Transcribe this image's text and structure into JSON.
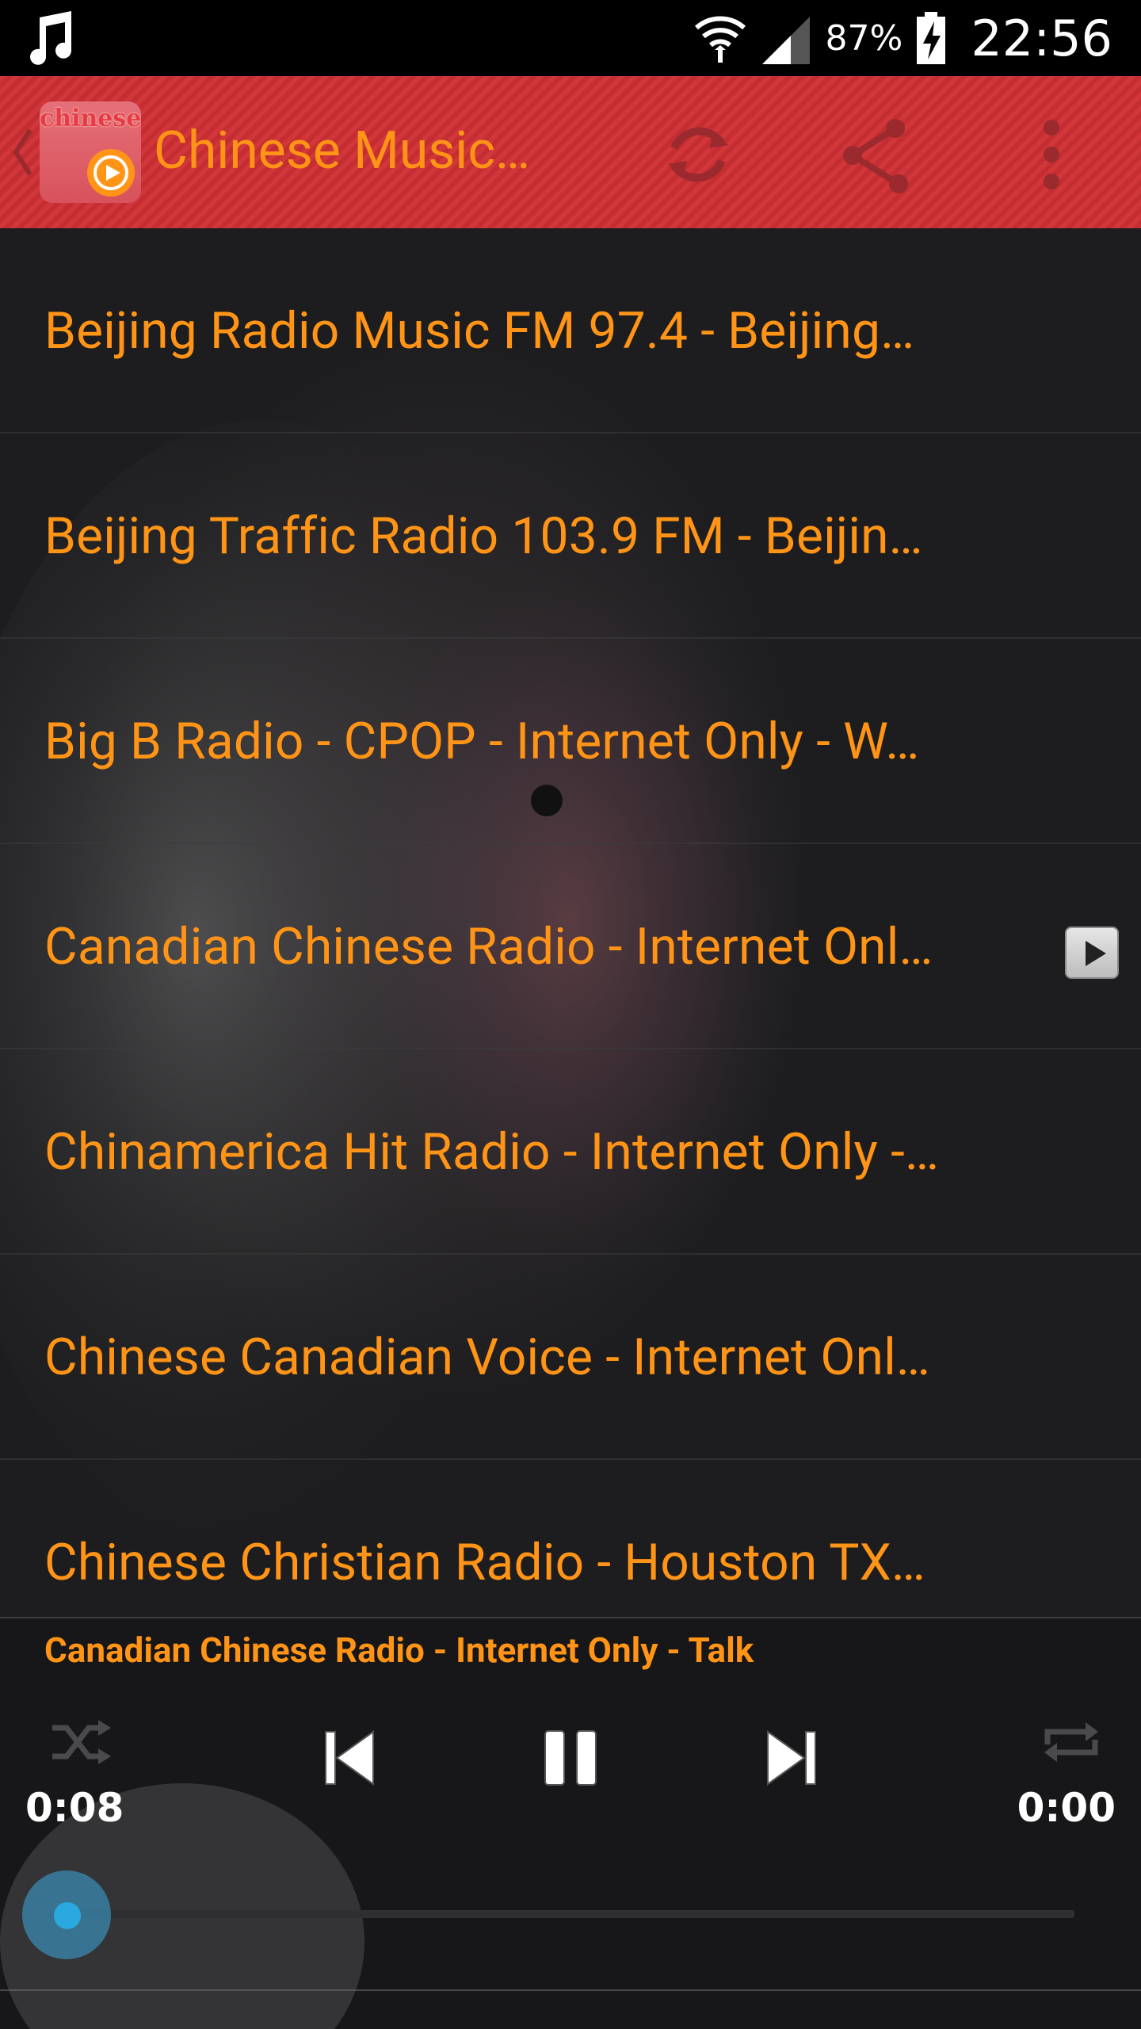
{
  "status_bar": {
    "battery_percent": "87%",
    "time": "22:56",
    "icons": [
      "music-note-icon",
      "wifi-icon",
      "signal-icon",
      "battery-charging-icon"
    ]
  },
  "app_bar": {
    "title": "Chinese Music…",
    "logo_text": "chinese",
    "actions": [
      "refresh-icon",
      "share-icon",
      "overflow-menu-icon"
    ]
  },
  "stations": [
    {
      "label": "Beijing Radio Music FM 97.4 - Beijing…",
      "playing": false
    },
    {
      "label": "Beijing Traffic Radio 103.9 FM - Beijin…",
      "playing": false
    },
    {
      "label": "Big B Radio - CPOP - Internet Only - W…",
      "playing": false
    },
    {
      "label": "Canadian Chinese Radio - Internet Onl…",
      "playing": true
    },
    {
      "label": "Chinamerica Hit Radio - Internet Only -…",
      "playing": false
    },
    {
      "label": "Chinese Canadian Voice - Internet Onl…",
      "playing": false
    },
    {
      "label": "Chinese Christian Radio - Houston TX…",
      "playing": false
    }
  ],
  "player": {
    "now_playing": "Canadian Chinese Radio - Internet Only - Talk",
    "elapsed": "0:08",
    "duration": "0:00",
    "progress_fraction": 0.0,
    "controls": [
      "shuffle-icon",
      "previous-icon",
      "pause-icon",
      "next-icon",
      "repeat-icon"
    ]
  },
  "colors": {
    "accent": "#ff9416",
    "app_bar": "#d0363a",
    "seek": "#2aa8e0"
  }
}
